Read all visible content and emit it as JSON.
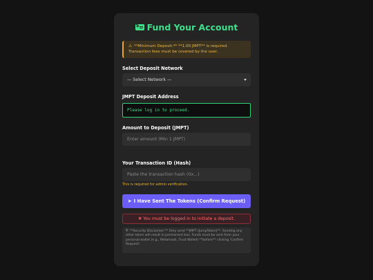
{
  "header": {
    "icon": "money-bill-icon",
    "title": "Fund Your Account",
    "accent_color": "#3fe08a"
  },
  "warning": {
    "icon": "warning-triangle-icon",
    "line1": "**Minimum Deposit:** **1.00 JMPT** is required.",
    "line2": "Transaction fees must be covered by the user."
  },
  "network": {
    "label": "Select Deposit Network",
    "selected": "— Select Network —"
  },
  "address": {
    "label": "JMPT Deposit Address",
    "value": "Please log in to proceed."
  },
  "amount": {
    "label": "Amount to Deposit (JMPT)",
    "placeholder": "Enter amount (Min 1 JMPT)"
  },
  "txid": {
    "label": "Your Transaction ID (Hash)",
    "placeholder": "Paste the transaction hash (0x...)",
    "hint": "This is required for admin verification."
  },
  "confirm_button": {
    "icon": "paper-plane-icon",
    "label": "I Have Sent The Tokens (Confirm Request)",
    "color": "#6a5ef6"
  },
  "error": {
    "icon": "x-icon",
    "message": "You must be logged in to initiate a deposit."
  },
  "disclaimer": {
    "icon": "shield-icon",
    "text": "**Security Disclaimer:** Only send **JMPT (JumpToken)**. Sending any other token will result in permanent loss. Funds must be sent from your personal wallet (e.g., Metamask, Trust Wallet) **before** clicking 'Confirm Request'."
  }
}
